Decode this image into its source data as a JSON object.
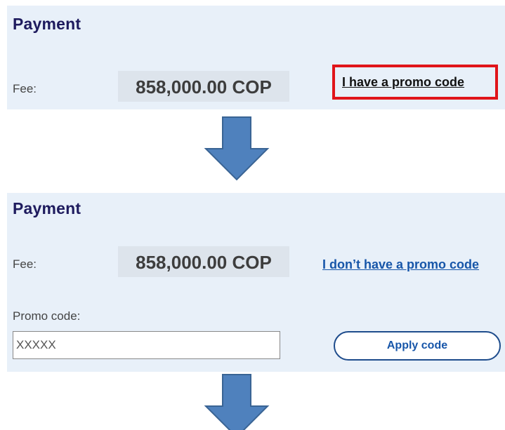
{
  "step1": {
    "title": "Payment",
    "fee_label": "Fee:",
    "fee_value": "858,000.00 COP",
    "promo_link": "I have a promo code",
    "highlight_color": "#e0141a"
  },
  "step2": {
    "title": "Payment",
    "fee_label": "Fee:",
    "fee_value": "858,000.00 COP",
    "no_promo_link": "I don’t have a promo code",
    "promo_label": "Promo code:",
    "promo_input_value": "XXXXX",
    "apply_button": "Apply code"
  },
  "arrows": [
    {
      "icon": "arrow-down-icon",
      "color": "#4f81bd"
    },
    {
      "icon": "arrow-down-icon",
      "color": "#4f81bd"
    }
  ],
  "colors": {
    "panel_background": "#e8f0f9",
    "title": "#1e1b5e",
    "link_blue": "#1756a9"
  }
}
